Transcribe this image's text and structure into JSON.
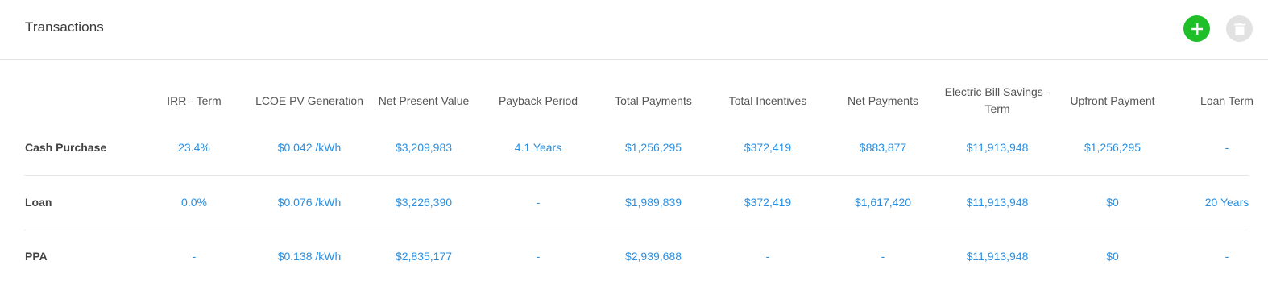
{
  "header": {
    "title": "Transactions",
    "add_icon": "plus-icon",
    "delete_icon": "trash-icon"
  },
  "colors": {
    "accent_value": "#2a8fe0",
    "add_button": "#1fbf2a",
    "delete_button": "#e2e2e2"
  },
  "table": {
    "columns": [
      "IRR - Term",
      "LCOE PV Generation",
      "Net Present Value",
      "Payback Period",
      "Total Payments",
      "Total Incentives",
      "Net Payments",
      "Electric Bill Savings - Term",
      "Upfront Payment",
      "Loan Term"
    ],
    "rows": [
      {
        "label": "Cash Purchase",
        "values": [
          "23.4%",
          "$0.042 /kWh",
          "$3,209,983",
          "4.1 Years",
          "$1,256,295",
          "$372,419",
          "$883,877",
          "$11,913,948",
          "$1,256,295",
          "-"
        ]
      },
      {
        "label": "Loan",
        "values": [
          "0.0%",
          "$0.076 /kWh",
          "$3,226,390",
          "-",
          "$1,989,839",
          "$372,419",
          "$1,617,420",
          "$11,913,948",
          "$0",
          "20 Years"
        ]
      },
      {
        "label": "PPA",
        "values": [
          "-",
          "$0.138 /kWh",
          "$2,835,177",
          "-",
          "$2,939,688",
          "-",
          "-",
          "$11,913,948",
          "$0",
          "-"
        ]
      }
    ]
  }
}
